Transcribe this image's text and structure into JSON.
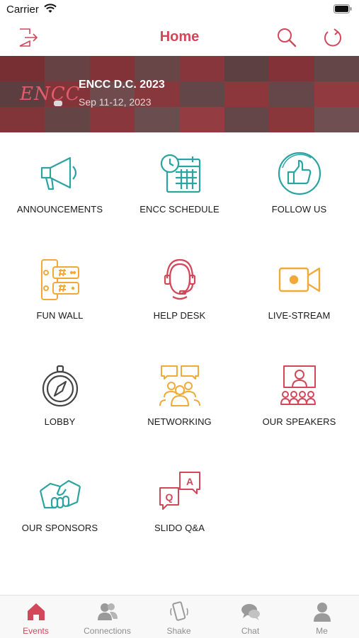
{
  "status": {
    "carrier": "Carrier"
  },
  "nav": {
    "title": "Home",
    "accent": "#d2475a"
  },
  "banner": {
    "logo": "ENCC",
    "title": "ENCC D.C. 2023",
    "date": "Sep 11-12, 2023"
  },
  "items": [
    {
      "label": "ANNOUNCEMENTS",
      "icon": "megaphone-icon",
      "color": "#2aa3a1"
    },
    {
      "label": "ENCC SCHEDULE",
      "icon": "calendar-clock-icon",
      "color": "#2aa3a1"
    },
    {
      "label": "FOLLOW US",
      "icon": "thumbs-up-icon",
      "color": "#2aa3a1"
    },
    {
      "label": "FUN WALL",
      "icon": "hashtag-chat-icon",
      "color": "#f1a93a"
    },
    {
      "label": "HELP DESK",
      "icon": "headset-agent-icon",
      "color": "#d2475a"
    },
    {
      "label": "LIVE-STREAM",
      "icon": "video-camera-icon",
      "color": "#f1a93a"
    },
    {
      "label": "LOBBY",
      "icon": "compass-icon",
      "color": "#444444"
    },
    {
      "label": "NETWORKING",
      "icon": "people-chat-icon",
      "color": "#f1a93a"
    },
    {
      "label": "OUR SPEAKERS",
      "icon": "presentation-audience-icon",
      "color": "#d2475a"
    },
    {
      "label": "OUR SPONSORS",
      "icon": "handshake-icon",
      "color": "#2aa3a1"
    },
    {
      "label": "SLIDO Q&A",
      "icon": "qa-bubbles-icon",
      "color": "#d2475a"
    }
  ],
  "tabs": [
    {
      "label": "Events",
      "icon": "home-icon",
      "active": true
    },
    {
      "label": "Connections",
      "icon": "users-icon",
      "active": false
    },
    {
      "label": "Shake",
      "icon": "phone-shake-icon",
      "active": false
    },
    {
      "label": "Chat",
      "icon": "chat-icon",
      "active": false
    },
    {
      "label": "Me",
      "icon": "person-icon",
      "active": false
    }
  ]
}
